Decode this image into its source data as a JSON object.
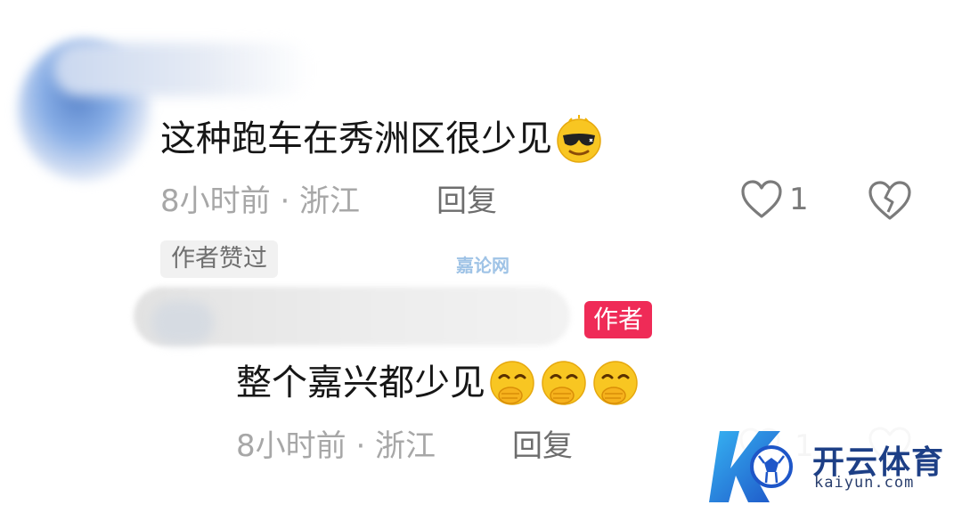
{
  "comment": {
    "text": "这种跑车在秀洲区很少见",
    "emoji": "sunglasses-emoji",
    "time": "8小时前 · 浙江",
    "reply_label": "回复",
    "like_count": "1",
    "author_liked_tag": "作者赞过"
  },
  "reply": {
    "author_badge": "作者",
    "text": "整个嘉兴都少见",
    "emojis": [
      "hand-over-mouth-emoji",
      "hand-over-mouth-emoji",
      "hand-over-mouth-emoji"
    ],
    "time": "8小时前 · 浙江",
    "reply_label": "回复",
    "like_count": "1"
  },
  "watermarks": {
    "center_text": "嘉论网",
    "logo_name": "开云体育",
    "logo_url": "kaiyun.com"
  },
  "colors": {
    "badge_red": "#ef2b57",
    "meta_gray": "#a7a7a7",
    "logo_blue": "#1d3f86"
  }
}
